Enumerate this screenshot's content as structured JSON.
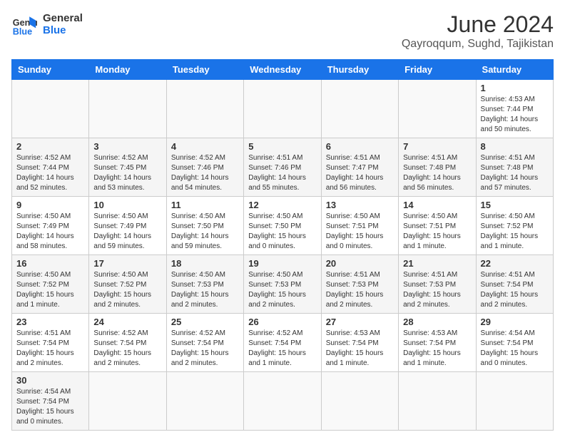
{
  "header": {
    "logo_general": "General",
    "logo_blue": "Blue",
    "title": "June 2024",
    "location": "Qayroqqum, Sughd, Tajikistan"
  },
  "weekdays": [
    "Sunday",
    "Monday",
    "Tuesday",
    "Wednesday",
    "Thursday",
    "Friday",
    "Saturday"
  ],
  "weeks": [
    [
      {
        "day": "",
        "info": ""
      },
      {
        "day": "",
        "info": ""
      },
      {
        "day": "",
        "info": ""
      },
      {
        "day": "",
        "info": ""
      },
      {
        "day": "",
        "info": ""
      },
      {
        "day": "",
        "info": ""
      },
      {
        "day": "1",
        "info": "Sunrise: 4:53 AM\nSunset: 7:44 PM\nDaylight: 14 hours\nand 50 minutes."
      }
    ],
    [
      {
        "day": "2",
        "info": "Sunrise: 4:52 AM\nSunset: 7:44 PM\nDaylight: 14 hours\nand 52 minutes."
      },
      {
        "day": "3",
        "info": "Sunrise: 4:52 AM\nSunset: 7:45 PM\nDaylight: 14 hours\nand 53 minutes."
      },
      {
        "day": "4",
        "info": "Sunrise: 4:52 AM\nSunset: 7:46 PM\nDaylight: 14 hours\nand 54 minutes."
      },
      {
        "day": "5",
        "info": "Sunrise: 4:51 AM\nSunset: 7:46 PM\nDaylight: 14 hours\nand 55 minutes."
      },
      {
        "day": "6",
        "info": "Sunrise: 4:51 AM\nSunset: 7:47 PM\nDaylight: 14 hours\nand 56 minutes."
      },
      {
        "day": "7",
        "info": "Sunrise: 4:51 AM\nSunset: 7:48 PM\nDaylight: 14 hours\nand 56 minutes."
      },
      {
        "day": "8",
        "info": "Sunrise: 4:51 AM\nSunset: 7:48 PM\nDaylight: 14 hours\nand 57 minutes."
      }
    ],
    [
      {
        "day": "9",
        "info": "Sunrise: 4:50 AM\nSunset: 7:49 PM\nDaylight: 14 hours\nand 58 minutes."
      },
      {
        "day": "10",
        "info": "Sunrise: 4:50 AM\nSunset: 7:49 PM\nDaylight: 14 hours\nand 59 minutes."
      },
      {
        "day": "11",
        "info": "Sunrise: 4:50 AM\nSunset: 7:50 PM\nDaylight: 14 hours\nand 59 minutes."
      },
      {
        "day": "12",
        "info": "Sunrise: 4:50 AM\nSunset: 7:50 PM\nDaylight: 15 hours\nand 0 minutes."
      },
      {
        "day": "13",
        "info": "Sunrise: 4:50 AM\nSunset: 7:51 PM\nDaylight: 15 hours\nand 0 minutes."
      },
      {
        "day": "14",
        "info": "Sunrise: 4:50 AM\nSunset: 7:51 PM\nDaylight: 15 hours\nand 1 minute."
      },
      {
        "day": "15",
        "info": "Sunrise: 4:50 AM\nSunset: 7:52 PM\nDaylight: 15 hours\nand 1 minute."
      }
    ],
    [
      {
        "day": "16",
        "info": "Sunrise: 4:50 AM\nSunset: 7:52 PM\nDaylight: 15 hours\nand 1 minute."
      },
      {
        "day": "17",
        "info": "Sunrise: 4:50 AM\nSunset: 7:52 PM\nDaylight: 15 hours\nand 2 minutes."
      },
      {
        "day": "18",
        "info": "Sunrise: 4:50 AM\nSunset: 7:53 PM\nDaylight: 15 hours\nand 2 minutes."
      },
      {
        "day": "19",
        "info": "Sunrise: 4:50 AM\nSunset: 7:53 PM\nDaylight: 15 hours\nand 2 minutes."
      },
      {
        "day": "20",
        "info": "Sunrise: 4:51 AM\nSunset: 7:53 PM\nDaylight: 15 hours\nand 2 minutes."
      },
      {
        "day": "21",
        "info": "Sunrise: 4:51 AM\nSunset: 7:53 PM\nDaylight: 15 hours\nand 2 minutes."
      },
      {
        "day": "22",
        "info": "Sunrise: 4:51 AM\nSunset: 7:54 PM\nDaylight: 15 hours\nand 2 minutes."
      }
    ],
    [
      {
        "day": "23",
        "info": "Sunrise: 4:51 AM\nSunset: 7:54 PM\nDaylight: 15 hours\nand 2 minutes."
      },
      {
        "day": "24",
        "info": "Sunrise: 4:52 AM\nSunset: 7:54 PM\nDaylight: 15 hours\nand 2 minutes."
      },
      {
        "day": "25",
        "info": "Sunrise: 4:52 AM\nSunset: 7:54 PM\nDaylight: 15 hours\nand 2 minutes."
      },
      {
        "day": "26",
        "info": "Sunrise: 4:52 AM\nSunset: 7:54 PM\nDaylight: 15 hours\nand 1 minute."
      },
      {
        "day": "27",
        "info": "Sunrise: 4:53 AM\nSunset: 7:54 PM\nDaylight: 15 hours\nand 1 minute."
      },
      {
        "day": "28",
        "info": "Sunrise: 4:53 AM\nSunset: 7:54 PM\nDaylight: 15 hours\nand 1 minute."
      },
      {
        "day": "29",
        "info": "Sunrise: 4:54 AM\nSunset: 7:54 PM\nDaylight: 15 hours\nand 0 minutes."
      }
    ],
    [
      {
        "day": "30",
        "info": "Sunrise: 4:54 AM\nSunset: 7:54 PM\nDaylight: 15 hours\nand 0 minutes."
      },
      {
        "day": "",
        "info": ""
      },
      {
        "day": "",
        "info": ""
      },
      {
        "day": "",
        "info": ""
      },
      {
        "day": "",
        "info": ""
      },
      {
        "day": "",
        "info": ""
      },
      {
        "day": "",
        "info": ""
      }
    ]
  ]
}
